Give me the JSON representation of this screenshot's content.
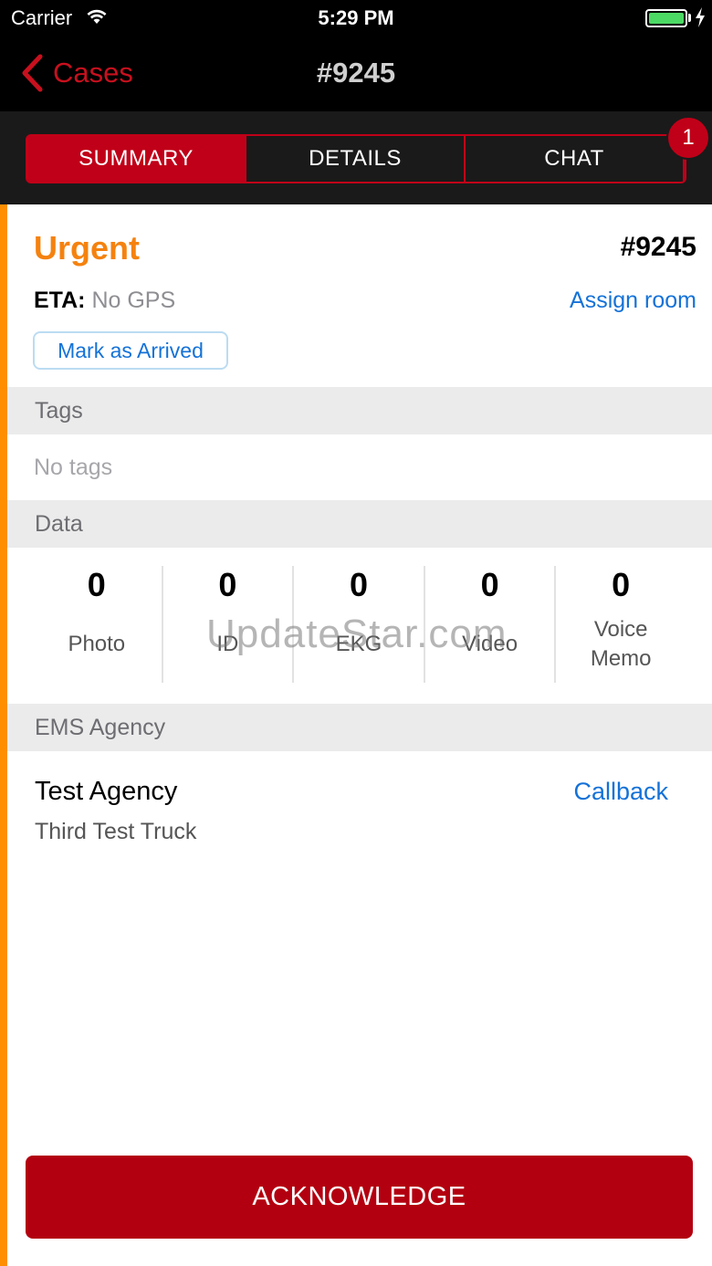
{
  "status_bar": {
    "carrier": "Carrier",
    "time": "5:29 PM",
    "battery_level": 1.0
  },
  "nav": {
    "back_label": "Cases",
    "title": "#9245"
  },
  "tabs": {
    "items": [
      {
        "label": "SUMMARY",
        "active": true
      },
      {
        "label": "DETAILS",
        "active": false
      },
      {
        "label": "CHAT",
        "active": false
      }
    ],
    "chat_badge": "1"
  },
  "summary": {
    "priority": "Urgent",
    "case_number": "#9245",
    "eta_label": "ETA:",
    "eta_value": "No GPS",
    "assign_room": "Assign room",
    "mark_arrived": "Mark as Arrived"
  },
  "tags": {
    "header": "Tags",
    "empty_text": "No tags"
  },
  "data_section": {
    "header": "Data",
    "items": [
      {
        "count": "0",
        "label": "Photo"
      },
      {
        "count": "0",
        "label": "ID"
      },
      {
        "count": "0",
        "label": "EKG"
      },
      {
        "count": "0",
        "label": "Video"
      },
      {
        "count": "0",
        "label_line1": "Voice",
        "label_line2": "Memo"
      }
    ]
  },
  "ems_agency": {
    "header": "EMS Agency",
    "name": "Test Agency",
    "unit": "Third Test Truck",
    "callback": "Callback"
  },
  "watermark": "UpdateStar.com",
  "acknowledge": "ACKNOWLEDGE",
  "colors": {
    "accent_red": "#c00018",
    "priority_orange": "#f5820f",
    "link_blue": "#1472d8",
    "battery_green": "#4cd964"
  },
  "icons": {
    "wifi": "wifi-icon",
    "battery": "battery-icon",
    "charging": "charging-bolt-icon",
    "back": "chevron-left-icon"
  }
}
